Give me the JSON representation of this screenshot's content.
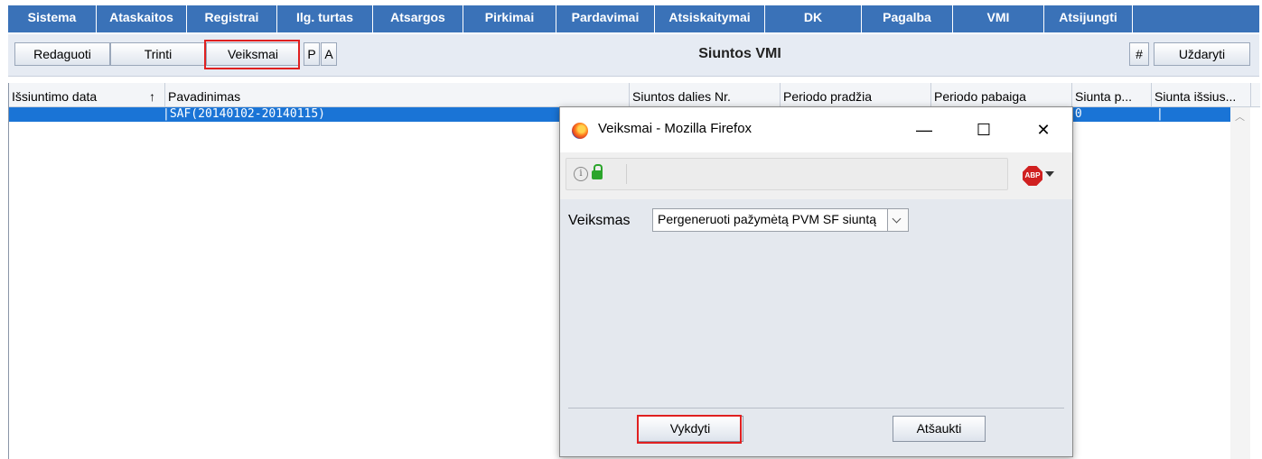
{
  "menu": {
    "items": [
      "Sistema",
      "Ataskaitos",
      "Registrai",
      "Ilg. turtas",
      "Atsargos",
      "Pirkimai",
      "Pardavimai",
      "Atsiskaitymai",
      "DK",
      "Pagalba",
      "VMI",
      "Atsijungti"
    ]
  },
  "toolbar": {
    "edit_label": "Redaguoti",
    "delete_label": "Trinti",
    "actions_label": "Veiksmai",
    "p_label": "P",
    "a_label": "A",
    "title": "Siuntos VMI",
    "hash_label": "#",
    "close_label": "Uždaryti"
  },
  "grid": {
    "columns": [
      "Išsiuntimo data",
      "Pavadinimas",
      "Siuntos dalies Nr.",
      "Periodo pradžia",
      "Periodo pabaiga",
      "Siunta p...",
      "Siunta išsius..."
    ],
    "sort_indicator": "↑",
    "rows": [
      {
        "pavadinimas": "|SAF(20140102-20140115)",
        "siunta_p": "|0",
        "siunta_issius": "|"
      }
    ]
  },
  "dialog": {
    "title": "Veiksmai - Mozilla Firefox",
    "minimize": "—",
    "maximize": "☐",
    "close": "✕",
    "abp_text": "ABP",
    "action_label": "Veiksmas",
    "action_value": "Pergeneruoti pažymėtą PVM SF siuntą",
    "execute_label": "Vykdyti",
    "cancel_label": "Atšaukti"
  },
  "colors": {
    "menu_bg": "#3a72b8",
    "selection": "#1a74d6",
    "highlight": "#e02020"
  }
}
